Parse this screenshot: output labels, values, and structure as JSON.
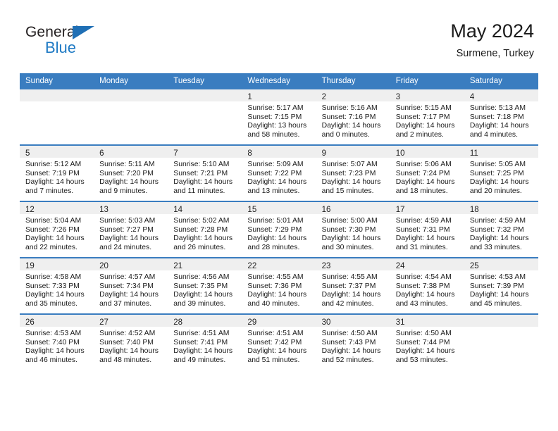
{
  "brand": {
    "name_dark": "General",
    "name_blue": "Blue",
    "accent_color": "#1f7ac4",
    "triangle_color": "#1f6fb5"
  },
  "header": {
    "title": "May 2024",
    "subtitle": "Surmene, Turkey"
  },
  "theme": {
    "header_row_bg": "#3a7dc0",
    "daynum_band_bg": "#efefef",
    "cell_bg": "#ffffff",
    "text_color": "#1a1a1a"
  },
  "weekday_headers": [
    "Sunday",
    "Monday",
    "Tuesday",
    "Wednesday",
    "Thursday",
    "Friday",
    "Saturday"
  ],
  "weeks": [
    [
      {
        "day": "",
        "empty": true,
        "sunrise": "",
        "sunset": "",
        "daylight_1": "",
        "daylight_2": ""
      },
      {
        "day": "",
        "empty": true,
        "sunrise": "",
        "sunset": "",
        "daylight_1": "",
        "daylight_2": ""
      },
      {
        "day": "",
        "empty": true,
        "sunrise": "",
        "sunset": "",
        "daylight_1": "",
        "daylight_2": ""
      },
      {
        "day": "1",
        "empty": false,
        "sunrise": "Sunrise: 5:17 AM",
        "sunset": "Sunset: 7:15 PM",
        "daylight_1": "Daylight: 13 hours",
        "daylight_2": "and 58 minutes."
      },
      {
        "day": "2",
        "empty": false,
        "sunrise": "Sunrise: 5:16 AM",
        "sunset": "Sunset: 7:16 PM",
        "daylight_1": "Daylight: 14 hours",
        "daylight_2": "and 0 minutes."
      },
      {
        "day": "3",
        "empty": false,
        "sunrise": "Sunrise: 5:15 AM",
        "sunset": "Sunset: 7:17 PM",
        "daylight_1": "Daylight: 14 hours",
        "daylight_2": "and 2 minutes."
      },
      {
        "day": "4",
        "empty": false,
        "sunrise": "Sunrise: 5:13 AM",
        "sunset": "Sunset: 7:18 PM",
        "daylight_1": "Daylight: 14 hours",
        "daylight_2": "and 4 minutes."
      }
    ],
    [
      {
        "day": "5",
        "empty": false,
        "sunrise": "Sunrise: 5:12 AM",
        "sunset": "Sunset: 7:19 PM",
        "daylight_1": "Daylight: 14 hours",
        "daylight_2": "and 7 minutes."
      },
      {
        "day": "6",
        "empty": false,
        "sunrise": "Sunrise: 5:11 AM",
        "sunset": "Sunset: 7:20 PM",
        "daylight_1": "Daylight: 14 hours",
        "daylight_2": "and 9 minutes."
      },
      {
        "day": "7",
        "empty": false,
        "sunrise": "Sunrise: 5:10 AM",
        "sunset": "Sunset: 7:21 PM",
        "daylight_1": "Daylight: 14 hours",
        "daylight_2": "and 11 minutes."
      },
      {
        "day": "8",
        "empty": false,
        "sunrise": "Sunrise: 5:09 AM",
        "sunset": "Sunset: 7:22 PM",
        "daylight_1": "Daylight: 14 hours",
        "daylight_2": "and 13 minutes."
      },
      {
        "day": "9",
        "empty": false,
        "sunrise": "Sunrise: 5:07 AM",
        "sunset": "Sunset: 7:23 PM",
        "daylight_1": "Daylight: 14 hours",
        "daylight_2": "and 15 minutes."
      },
      {
        "day": "10",
        "empty": false,
        "sunrise": "Sunrise: 5:06 AM",
        "sunset": "Sunset: 7:24 PM",
        "daylight_1": "Daylight: 14 hours",
        "daylight_2": "and 18 minutes."
      },
      {
        "day": "11",
        "empty": false,
        "sunrise": "Sunrise: 5:05 AM",
        "sunset": "Sunset: 7:25 PM",
        "daylight_1": "Daylight: 14 hours",
        "daylight_2": "and 20 minutes."
      }
    ],
    [
      {
        "day": "12",
        "empty": false,
        "sunrise": "Sunrise: 5:04 AM",
        "sunset": "Sunset: 7:26 PM",
        "daylight_1": "Daylight: 14 hours",
        "daylight_2": "and 22 minutes."
      },
      {
        "day": "13",
        "empty": false,
        "sunrise": "Sunrise: 5:03 AM",
        "sunset": "Sunset: 7:27 PM",
        "daylight_1": "Daylight: 14 hours",
        "daylight_2": "and 24 minutes."
      },
      {
        "day": "14",
        "empty": false,
        "sunrise": "Sunrise: 5:02 AM",
        "sunset": "Sunset: 7:28 PM",
        "daylight_1": "Daylight: 14 hours",
        "daylight_2": "and 26 minutes."
      },
      {
        "day": "15",
        "empty": false,
        "sunrise": "Sunrise: 5:01 AM",
        "sunset": "Sunset: 7:29 PM",
        "daylight_1": "Daylight: 14 hours",
        "daylight_2": "and 28 minutes."
      },
      {
        "day": "16",
        "empty": false,
        "sunrise": "Sunrise: 5:00 AM",
        "sunset": "Sunset: 7:30 PM",
        "daylight_1": "Daylight: 14 hours",
        "daylight_2": "and 30 minutes."
      },
      {
        "day": "17",
        "empty": false,
        "sunrise": "Sunrise: 4:59 AM",
        "sunset": "Sunset: 7:31 PM",
        "daylight_1": "Daylight: 14 hours",
        "daylight_2": "and 31 minutes."
      },
      {
        "day": "18",
        "empty": false,
        "sunrise": "Sunrise: 4:59 AM",
        "sunset": "Sunset: 7:32 PM",
        "daylight_1": "Daylight: 14 hours",
        "daylight_2": "and 33 minutes."
      }
    ],
    [
      {
        "day": "19",
        "empty": false,
        "sunrise": "Sunrise: 4:58 AM",
        "sunset": "Sunset: 7:33 PM",
        "daylight_1": "Daylight: 14 hours",
        "daylight_2": "and 35 minutes."
      },
      {
        "day": "20",
        "empty": false,
        "sunrise": "Sunrise: 4:57 AM",
        "sunset": "Sunset: 7:34 PM",
        "daylight_1": "Daylight: 14 hours",
        "daylight_2": "and 37 minutes."
      },
      {
        "day": "21",
        "empty": false,
        "sunrise": "Sunrise: 4:56 AM",
        "sunset": "Sunset: 7:35 PM",
        "daylight_1": "Daylight: 14 hours",
        "daylight_2": "and 39 minutes."
      },
      {
        "day": "22",
        "empty": false,
        "sunrise": "Sunrise: 4:55 AM",
        "sunset": "Sunset: 7:36 PM",
        "daylight_1": "Daylight: 14 hours",
        "daylight_2": "and 40 minutes."
      },
      {
        "day": "23",
        "empty": false,
        "sunrise": "Sunrise: 4:55 AM",
        "sunset": "Sunset: 7:37 PM",
        "daylight_1": "Daylight: 14 hours",
        "daylight_2": "and 42 minutes."
      },
      {
        "day": "24",
        "empty": false,
        "sunrise": "Sunrise: 4:54 AM",
        "sunset": "Sunset: 7:38 PM",
        "daylight_1": "Daylight: 14 hours",
        "daylight_2": "and 43 minutes."
      },
      {
        "day": "25",
        "empty": false,
        "sunrise": "Sunrise: 4:53 AM",
        "sunset": "Sunset: 7:39 PM",
        "daylight_1": "Daylight: 14 hours",
        "daylight_2": "and 45 minutes."
      }
    ],
    [
      {
        "day": "26",
        "empty": false,
        "sunrise": "Sunrise: 4:53 AM",
        "sunset": "Sunset: 7:40 PM",
        "daylight_1": "Daylight: 14 hours",
        "daylight_2": "and 46 minutes."
      },
      {
        "day": "27",
        "empty": false,
        "sunrise": "Sunrise: 4:52 AM",
        "sunset": "Sunset: 7:40 PM",
        "daylight_1": "Daylight: 14 hours",
        "daylight_2": "and 48 minutes."
      },
      {
        "day": "28",
        "empty": false,
        "sunrise": "Sunrise: 4:51 AM",
        "sunset": "Sunset: 7:41 PM",
        "daylight_1": "Daylight: 14 hours",
        "daylight_2": "and 49 minutes."
      },
      {
        "day": "29",
        "empty": false,
        "sunrise": "Sunrise: 4:51 AM",
        "sunset": "Sunset: 7:42 PM",
        "daylight_1": "Daylight: 14 hours",
        "daylight_2": "and 51 minutes."
      },
      {
        "day": "30",
        "empty": false,
        "sunrise": "Sunrise: 4:50 AM",
        "sunset": "Sunset: 7:43 PM",
        "daylight_1": "Daylight: 14 hours",
        "daylight_2": "and 52 minutes."
      },
      {
        "day": "31",
        "empty": false,
        "sunrise": "Sunrise: 4:50 AM",
        "sunset": "Sunset: 7:44 PM",
        "daylight_1": "Daylight: 14 hours",
        "daylight_2": "and 53 minutes."
      },
      {
        "day": "",
        "empty": true,
        "sunrise": "",
        "sunset": "",
        "daylight_1": "",
        "daylight_2": ""
      }
    ]
  ]
}
